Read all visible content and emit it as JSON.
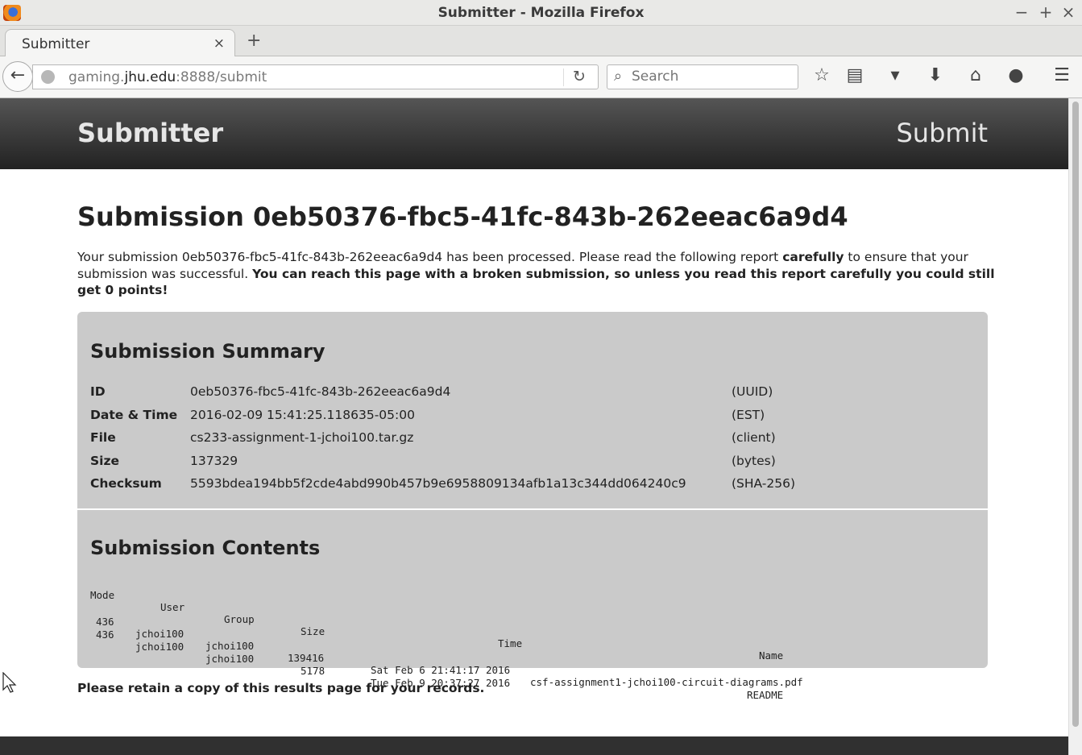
{
  "window": {
    "title": "Submitter - Mozilla Firefox",
    "minimize": "−",
    "maximize": "+",
    "close": "×"
  },
  "tabs": [
    {
      "label": "Submitter",
      "close": "×"
    }
  ],
  "newtab_label": "+",
  "nav": {
    "url_prefix": "gaming.",
    "url_domain": "jhu.edu",
    "url_suffix": ":8888/submit",
    "search_placeholder": "Search"
  },
  "header": {
    "brand": "Submitter",
    "submit_link": "Submit"
  },
  "page": {
    "title": "Submission 0eb50376-fbc5-41fc-843b-262eeac6a9d4",
    "intro_1": "Your submission 0eb50376-fbc5-41fc-843b-262eeac6a9d4 has been processed. Please read the following report ",
    "intro_bold_1": "carefully",
    "intro_2": " to ensure that your submission was successful. ",
    "intro_bold_2": "You can reach this page with a broken submission, so unless you read this report carefully you could still get 0 points!",
    "retain_note": "Please retain a copy of this results page for your records."
  },
  "summary": {
    "heading": "Submission Summary",
    "rows": [
      {
        "key": "ID",
        "value": "0eb50376-fbc5-41fc-843b-262eeac6a9d4",
        "unit": "(UUID)"
      },
      {
        "key": "Date & Time",
        "value": "2016-02-09 15:41:25.118635-05:00",
        "unit": "(EST)"
      },
      {
        "key": "File",
        "value": "cs233-assignment-1-jchoi100.tar.gz",
        "unit": "(client)"
      },
      {
        "key": "Size",
        "value": "137329",
        "unit": "(bytes)"
      },
      {
        "key": "Checksum",
        "value": "5593bdea194bb5f2cde4abd990b457b9e6958809134afb1a13c344dd064240c9",
        "unit": "(SHA-256)"
      }
    ]
  },
  "contents": {
    "heading": "Submission Contents",
    "columns": [
      "Mode",
      "User",
      "Group",
      "Size",
      "Time",
      "Name"
    ],
    "rows": [
      [
        "436",
        "jchoi100",
        "jchoi100",
        "139416",
        "Sat Feb  6 21:41:17 2016",
        "csf-assignment1-jchoi100-circuit-diagrams.pdf"
      ],
      [
        "436",
        "jchoi100",
        "jchoi100",
        "5178",
        "Tue Feb  9 20:37:27 2016",
        "README"
      ]
    ]
  }
}
